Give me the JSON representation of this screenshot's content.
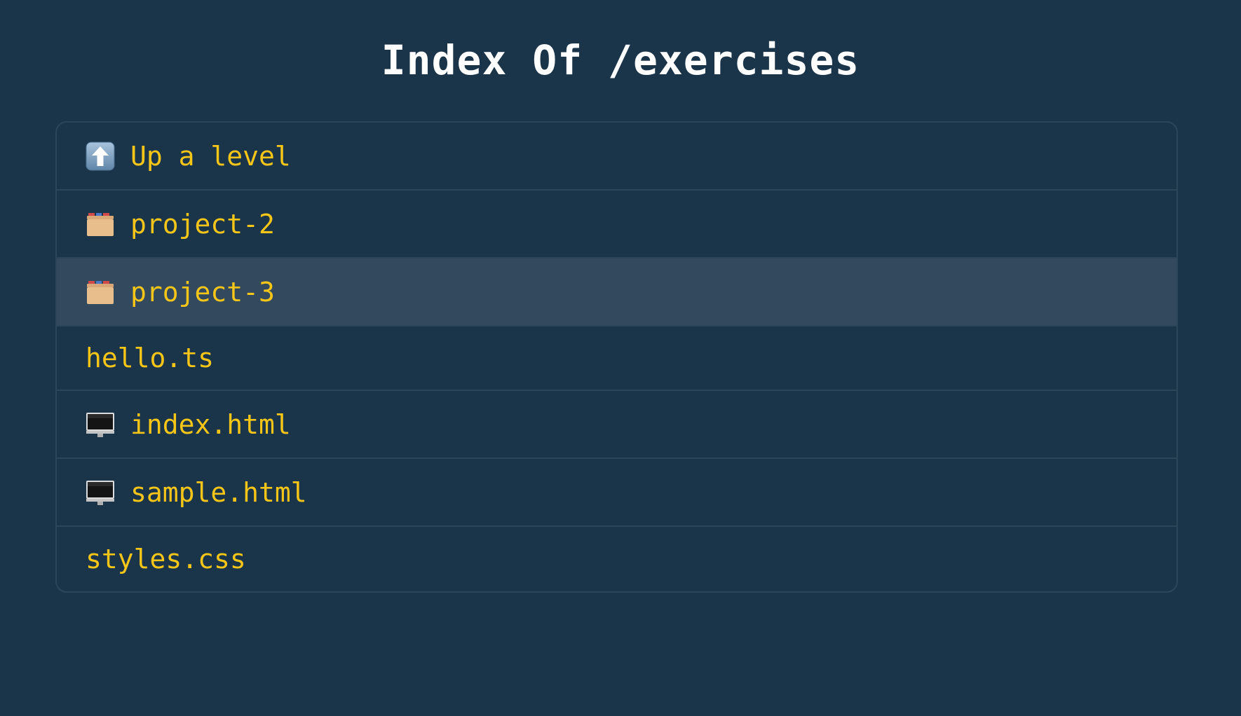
{
  "page": {
    "title": "Index Of /exercises"
  },
  "entries": [
    {
      "label": "Up a level",
      "icon": "up-arrow-icon"
    },
    {
      "label": "project-2",
      "icon": "folder-icon"
    },
    {
      "label": "project-3",
      "icon": "folder-icon",
      "state": "hovered"
    },
    {
      "label": "hello.ts",
      "icon": null
    },
    {
      "label": "index.html",
      "icon": "monitor-icon"
    },
    {
      "label": "sample.html",
      "icon": "monitor-icon"
    },
    {
      "label": "styles.css",
      "icon": null
    }
  ],
  "colors": {
    "background": "#1a344a",
    "row_hover": "#32495e",
    "border": "#2b4659",
    "link_text": "#f5c518",
    "title_text": "#ffffff"
  }
}
